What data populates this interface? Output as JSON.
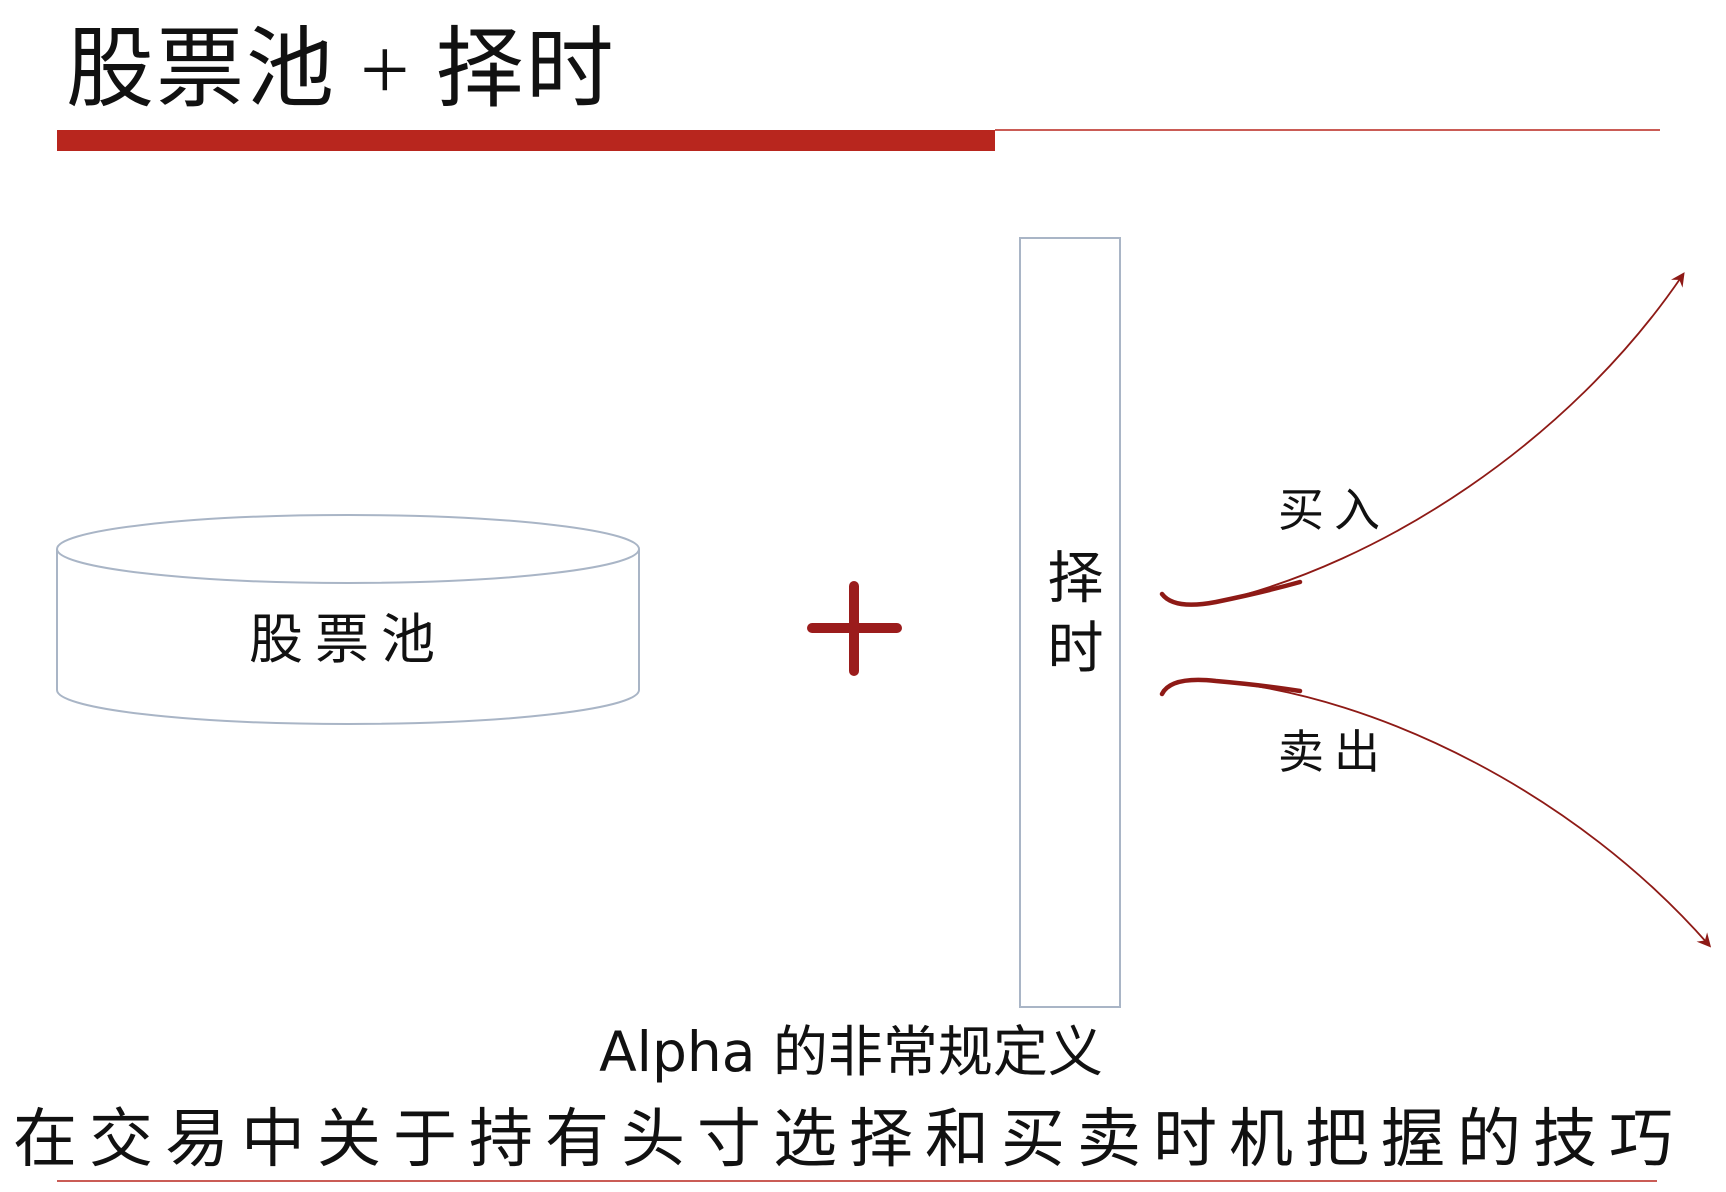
{
  "slide": {
    "title": "股票池 + 择时"
  },
  "diagram": {
    "pool_label": "股票池",
    "plus_symbol": "+",
    "timing_label": "择时",
    "buy_label": "买入",
    "sell_label": "卖出"
  },
  "caption": {
    "alpha_title": "Alpha 的非常规定义",
    "definition": "在交易中关于持有头寸选择和买卖时机把握的技巧"
  },
  "colors": {
    "accent_red": "#b8261e",
    "dark_red": "#8e1a16",
    "outline_gray": "#a9b5c6",
    "text": "#111111"
  }
}
